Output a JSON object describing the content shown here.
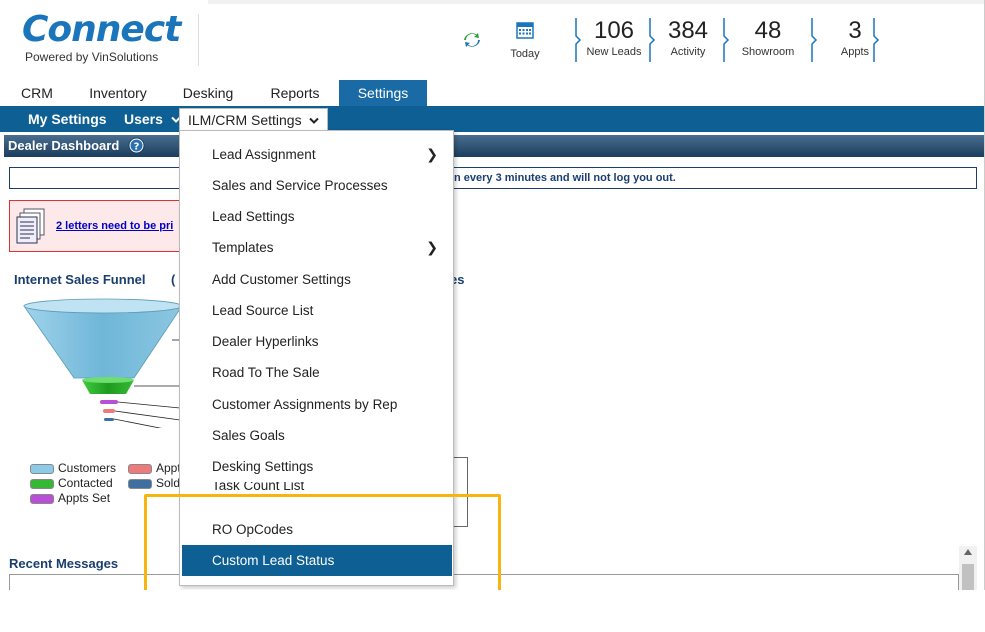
{
  "header": {
    "logo": "Connect",
    "logo_sub": "Powered by VinSolutions",
    "today_label": "Today",
    "stats": [
      {
        "value": "106",
        "label": "New Leads"
      },
      {
        "value": "384",
        "label": "Activity"
      },
      {
        "value": "48",
        "label": "Showroom"
      },
      {
        "value": "3",
        "label": "Appts"
      }
    ]
  },
  "tabs": [
    {
      "label": "CRM"
    },
    {
      "label": "Inventory"
    },
    {
      "label": "Desking"
    },
    {
      "label": "Reports"
    },
    {
      "label": "Settings",
      "active": true
    }
  ],
  "subnav": {
    "my_settings": "My Settings",
    "users": "Users",
    "ilm_crm": "ILM/CRM Settings"
  },
  "dashboard": {
    "title": "Dealer Dashboard",
    "info_text": "n every 3 minutes and will not log you out.",
    "alert_link": "2 letters need to be pri",
    "funnel_title": "Internet Sales Funnel",
    "funnel_link": "(",
    "behind_title": "es",
    "recent_title": "Recent Messages",
    "legend": [
      {
        "label": "Customers",
        "color": "#8ccbe8"
      },
      {
        "label": "Contacted",
        "color": "#35b935"
      },
      {
        "label": "Appts Set",
        "color": "#b84fd6"
      },
      {
        "label": "Appt",
        "color": "#ee7b7b"
      },
      {
        "label": "Sold",
        "color": "#3f6fa0"
      }
    ]
  },
  "menu": {
    "items": [
      {
        "label": "Lead Assignment",
        "submenu": true
      },
      {
        "label": "Sales and Service Processes"
      },
      {
        "label": "Lead Settings"
      },
      {
        "label": "Templates",
        "submenu": true
      },
      {
        "label": "Add Customer Settings"
      },
      {
        "label": "Lead Source List"
      },
      {
        "label": "Dealer Hyperlinks"
      },
      {
        "label": "Road To The Sale"
      },
      {
        "label": "Customer Assignments by Rep"
      },
      {
        "label": "Sales Goals"
      },
      {
        "label": "Desking Settings"
      },
      {
        "label": "Task Count List"
      },
      {
        "label": "RO OpCodes"
      },
      {
        "label": "Custom Lead Status",
        "selected": true
      }
    ],
    "submenu_arrow": "❯"
  },
  "colors": {
    "brand_blue": "#1b75bb",
    "nav_blue": "#0d5f94",
    "highlight": "#f6b511"
  }
}
